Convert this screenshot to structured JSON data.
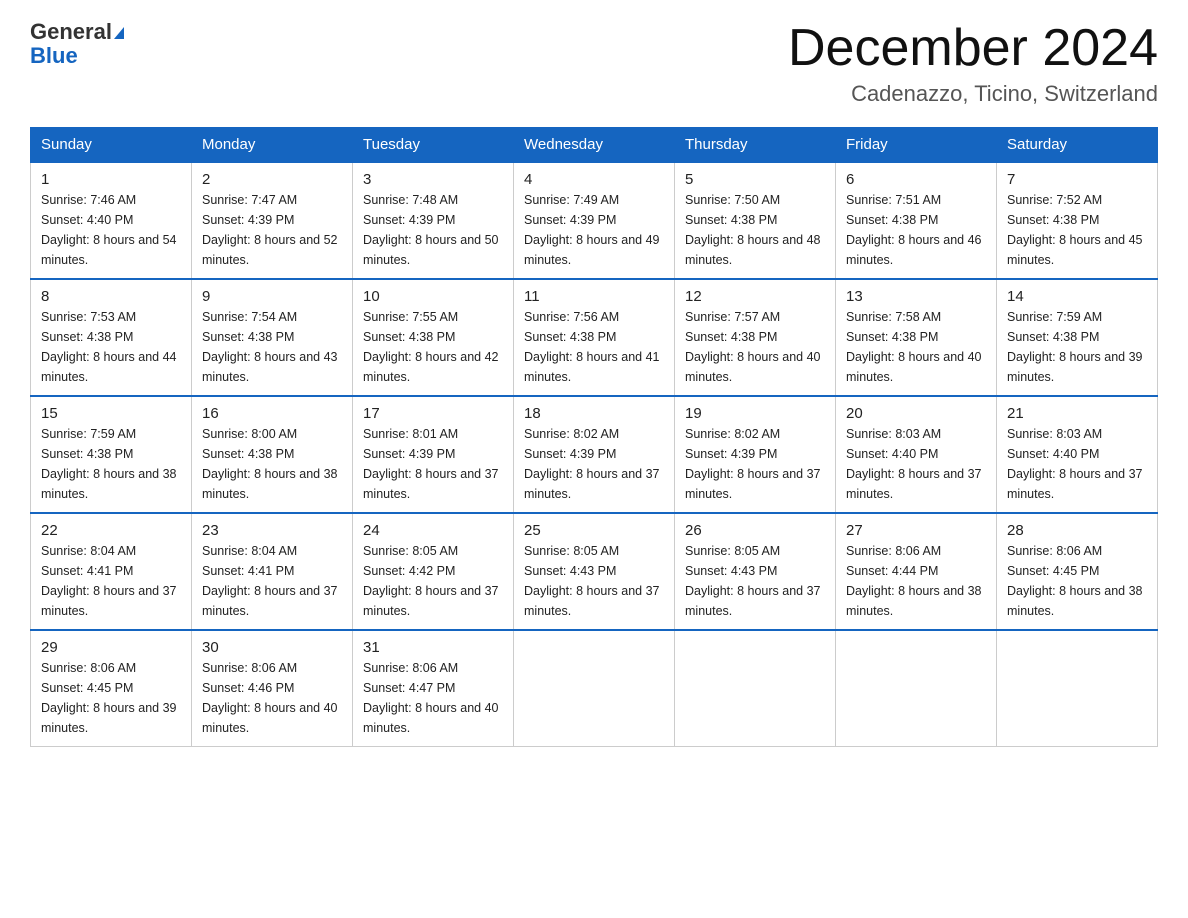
{
  "header": {
    "logo_line1": "General",
    "logo_line2": "Blue",
    "month_title": "December 2024",
    "location": "Cadenazzo, Ticino, Switzerland"
  },
  "days_of_week": [
    "Sunday",
    "Monday",
    "Tuesday",
    "Wednesday",
    "Thursday",
    "Friday",
    "Saturday"
  ],
  "weeks": [
    [
      {
        "day": 1,
        "sunrise": "7:46 AM",
        "sunset": "4:40 PM",
        "daylight": "8 hours and 54 minutes."
      },
      {
        "day": 2,
        "sunrise": "7:47 AM",
        "sunset": "4:39 PM",
        "daylight": "8 hours and 52 minutes."
      },
      {
        "day": 3,
        "sunrise": "7:48 AM",
        "sunset": "4:39 PM",
        "daylight": "8 hours and 50 minutes."
      },
      {
        "day": 4,
        "sunrise": "7:49 AM",
        "sunset": "4:39 PM",
        "daylight": "8 hours and 49 minutes."
      },
      {
        "day": 5,
        "sunrise": "7:50 AM",
        "sunset": "4:38 PM",
        "daylight": "8 hours and 48 minutes."
      },
      {
        "day": 6,
        "sunrise": "7:51 AM",
        "sunset": "4:38 PM",
        "daylight": "8 hours and 46 minutes."
      },
      {
        "day": 7,
        "sunrise": "7:52 AM",
        "sunset": "4:38 PM",
        "daylight": "8 hours and 45 minutes."
      }
    ],
    [
      {
        "day": 8,
        "sunrise": "7:53 AM",
        "sunset": "4:38 PM",
        "daylight": "8 hours and 44 minutes."
      },
      {
        "day": 9,
        "sunrise": "7:54 AM",
        "sunset": "4:38 PM",
        "daylight": "8 hours and 43 minutes."
      },
      {
        "day": 10,
        "sunrise": "7:55 AM",
        "sunset": "4:38 PM",
        "daylight": "8 hours and 42 minutes."
      },
      {
        "day": 11,
        "sunrise": "7:56 AM",
        "sunset": "4:38 PM",
        "daylight": "8 hours and 41 minutes."
      },
      {
        "day": 12,
        "sunrise": "7:57 AM",
        "sunset": "4:38 PM",
        "daylight": "8 hours and 40 minutes."
      },
      {
        "day": 13,
        "sunrise": "7:58 AM",
        "sunset": "4:38 PM",
        "daylight": "8 hours and 40 minutes."
      },
      {
        "day": 14,
        "sunrise": "7:59 AM",
        "sunset": "4:38 PM",
        "daylight": "8 hours and 39 minutes."
      }
    ],
    [
      {
        "day": 15,
        "sunrise": "7:59 AM",
        "sunset": "4:38 PM",
        "daylight": "8 hours and 38 minutes."
      },
      {
        "day": 16,
        "sunrise": "8:00 AM",
        "sunset": "4:38 PM",
        "daylight": "8 hours and 38 minutes."
      },
      {
        "day": 17,
        "sunrise": "8:01 AM",
        "sunset": "4:39 PM",
        "daylight": "8 hours and 37 minutes."
      },
      {
        "day": 18,
        "sunrise": "8:02 AM",
        "sunset": "4:39 PM",
        "daylight": "8 hours and 37 minutes."
      },
      {
        "day": 19,
        "sunrise": "8:02 AM",
        "sunset": "4:39 PM",
        "daylight": "8 hours and 37 minutes."
      },
      {
        "day": 20,
        "sunrise": "8:03 AM",
        "sunset": "4:40 PM",
        "daylight": "8 hours and 37 minutes."
      },
      {
        "day": 21,
        "sunrise": "8:03 AM",
        "sunset": "4:40 PM",
        "daylight": "8 hours and 37 minutes."
      }
    ],
    [
      {
        "day": 22,
        "sunrise": "8:04 AM",
        "sunset": "4:41 PM",
        "daylight": "8 hours and 37 minutes."
      },
      {
        "day": 23,
        "sunrise": "8:04 AM",
        "sunset": "4:41 PM",
        "daylight": "8 hours and 37 minutes."
      },
      {
        "day": 24,
        "sunrise": "8:05 AM",
        "sunset": "4:42 PM",
        "daylight": "8 hours and 37 minutes."
      },
      {
        "day": 25,
        "sunrise": "8:05 AM",
        "sunset": "4:43 PM",
        "daylight": "8 hours and 37 minutes."
      },
      {
        "day": 26,
        "sunrise": "8:05 AM",
        "sunset": "4:43 PM",
        "daylight": "8 hours and 37 minutes."
      },
      {
        "day": 27,
        "sunrise": "8:06 AM",
        "sunset": "4:44 PM",
        "daylight": "8 hours and 38 minutes."
      },
      {
        "day": 28,
        "sunrise": "8:06 AM",
        "sunset": "4:45 PM",
        "daylight": "8 hours and 38 minutes."
      }
    ],
    [
      {
        "day": 29,
        "sunrise": "8:06 AM",
        "sunset": "4:45 PM",
        "daylight": "8 hours and 39 minutes."
      },
      {
        "day": 30,
        "sunrise": "8:06 AM",
        "sunset": "4:46 PM",
        "daylight": "8 hours and 40 minutes."
      },
      {
        "day": 31,
        "sunrise": "8:06 AM",
        "sunset": "4:47 PM",
        "daylight": "8 hours and 40 minutes."
      },
      null,
      null,
      null,
      null
    ]
  ]
}
